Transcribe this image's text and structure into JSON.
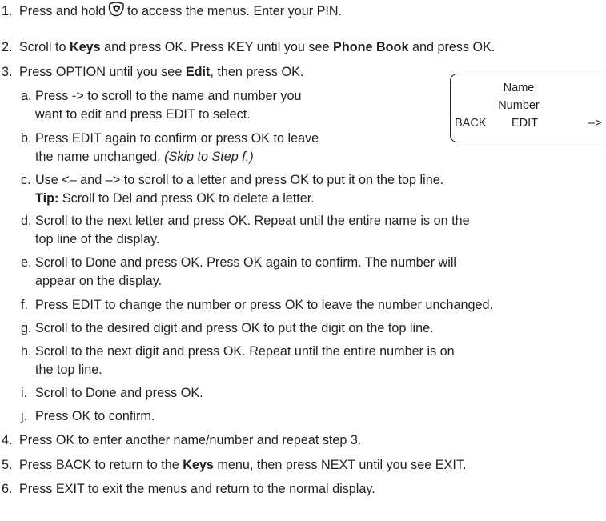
{
  "step1": {
    "num": "1.",
    "before": "Press and hold",
    "after": "to access the menus. Enter your PIN.",
    "icon": "menu-key-icon"
  },
  "step2": {
    "num": "2.",
    "t1": "Scroll to ",
    "b1": "Keys",
    "t2": " and press OK. Press KEY until you see ",
    "b2": "Phone Book",
    "t3": " and press OK."
  },
  "step3": {
    "num": "3.",
    "t1": "Press OPTION until you see ",
    "b1": "Edit",
    "t2": ", then press OK."
  },
  "sub_a": {
    "letter": "a.",
    "line1": "Press -> to scroll to the name and number you",
    "line2": "want to edit and press EDIT to select."
  },
  "sub_b": {
    "letter": "b.",
    "line1": "Press EDIT again to confirm or press OK to leave",
    "line2_plain": "the name unchanged. ",
    "line2_italic": "(Skip to Step f.)"
  },
  "sub_c": {
    "letter": "c.",
    "line1": "Use <– and –> to scroll to a letter and press OK to put it on the top line.",
    "tip_label": "Tip:",
    "tip_text": " Scroll to Del and press OK to delete a letter."
  },
  "sub_d": {
    "letter": "d.",
    "line1": "Scroll to the next letter and press OK. Repeat until the entire name is on the",
    "line2": "top line of the display."
  },
  "sub_e": {
    "letter": "e.",
    "line1": "Scroll to Done and press OK. Press OK again to confirm. The number will",
    "line2": "appear on the display."
  },
  "sub_f": {
    "letter": "f.",
    "line1": "Press EDIT to change the number or press OK to leave the number unchanged."
  },
  "sub_g": {
    "letter": "g.",
    "line1": "Scroll to the desired digit and press OK to put the digit on the top line."
  },
  "sub_h": {
    "letter": "h.",
    "line1": "Scroll to the next digit and press OK. Repeat until the entire number is on",
    "line2": "the top line."
  },
  "sub_i": {
    "letter": "i.",
    "line1": "Scroll to Done and press OK."
  },
  "sub_j": {
    "letter": "j.",
    "line1": "Press OK to confirm."
  },
  "step4": {
    "num": "4.",
    "text": "Press OK to enter another name/number and repeat step 3."
  },
  "step5": {
    "num": "5.",
    "t1": "Press BACK to return to the ",
    "b1": "Keys",
    "t2": " menu, then press NEXT until you see EXIT."
  },
  "step6": {
    "num": "6.",
    "text": "Press EXIT to exit the menus and return to the normal display."
  },
  "display": {
    "line1": "Name",
    "line2": "Number",
    "soft_left": "BACK",
    "soft_center": "EDIT",
    "soft_right": "–>"
  }
}
